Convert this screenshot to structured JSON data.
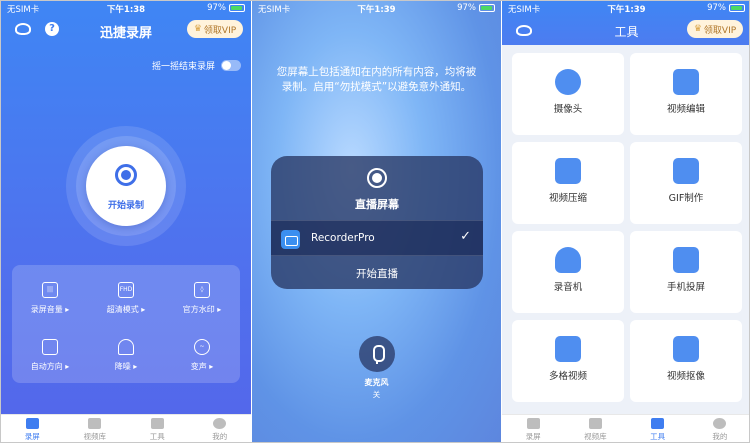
{
  "colors": {
    "brand": "#3f7df0",
    "vip_text": "#b0772a"
  },
  "status_left": {
    "carrier": "无SIM卡",
    "wifi_icon": "wifi-icon"
  },
  "panel1": {
    "status": {
      "carrier": "无SIM卡",
      "time": "下午1:38",
      "battery": "97%"
    },
    "title": "迅捷录屏",
    "vip_label": "领取VIP",
    "shake_label": "摇一摇结束录屏",
    "record_label": "开始录制",
    "features": [
      {
        "label": "录屏音量 ▸",
        "icon": "volume-icon"
      },
      {
        "label": "超清模式 ▸",
        "icon": "fhd-icon"
      },
      {
        "label": "官方水印 ▸",
        "icon": "watermark-icon"
      },
      {
        "label": "自动方向 ▸",
        "icon": "orientation-icon"
      },
      {
        "label": "降噪 ▸",
        "icon": "headphones-icon"
      },
      {
        "label": "变声 ▸",
        "icon": "voice-changer-icon"
      }
    ],
    "tabs": [
      {
        "label": "录屏",
        "icon": "camera-icon"
      },
      {
        "label": "视频库",
        "icon": "video-library-icon"
      },
      {
        "label": "工具",
        "icon": "toolbox-icon"
      },
      {
        "label": "我的",
        "icon": "profile-icon"
      }
    ]
  },
  "panel2": {
    "status": {
      "carrier": "无SIM卡",
      "time": "下午1:39",
      "battery": "97%"
    },
    "message": "您屏幕上包括通知在内的所有内容，均将被录制。启用“勿扰模式”以避免意外通知。",
    "card_title": "直播屏幕",
    "app_name": "RecorderPro",
    "check": "✓",
    "start_label": "开始直播",
    "mic_label": "麦克风",
    "mic_state": "关"
  },
  "panel3": {
    "status": {
      "carrier": "无SIM卡",
      "time": "下午1:39",
      "battery": "97%"
    },
    "title": "工具",
    "vip_label": "领取VIP",
    "tools": [
      {
        "label": "摄像头",
        "icon": "webcam-icon"
      },
      {
        "label": "视频编辑",
        "icon": "video-edit-icon"
      },
      {
        "label": "视频压缩",
        "icon": "compress-icon"
      },
      {
        "label": "GIF制作",
        "icon": "gif-icon"
      },
      {
        "label": "录音机",
        "icon": "microphone-icon"
      },
      {
        "label": "手机投屏",
        "icon": "cast-icon"
      },
      {
        "label": "多格视频",
        "icon": "grid-video-icon"
      },
      {
        "label": "视频抠像",
        "icon": "cutout-icon"
      }
    ],
    "tabs": [
      {
        "label": "录屏",
        "icon": "camera-icon"
      },
      {
        "label": "视频库",
        "icon": "video-library-icon"
      },
      {
        "label": "工具",
        "icon": "toolbox-icon"
      },
      {
        "label": "我的",
        "icon": "profile-icon"
      }
    ]
  }
}
